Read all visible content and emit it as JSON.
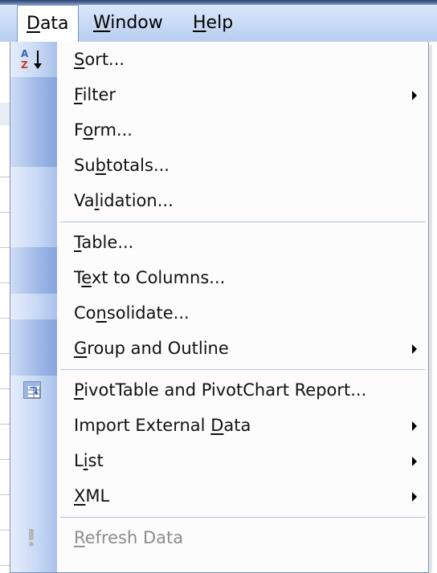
{
  "menubar": {
    "items": [
      {
        "label": "Data",
        "mnemonic_index": 0,
        "active": true
      },
      {
        "label": "Window",
        "mnemonic_index": 0,
        "active": false
      },
      {
        "label": "Help",
        "mnemonic_index": 0,
        "active": false
      }
    ]
  },
  "data_menu": {
    "items": [
      {
        "label": "Sort...",
        "mnemonic_index": 0,
        "icon": "sort-az-icon",
        "submenu": false,
        "disabled": false
      },
      {
        "label": "Filter",
        "mnemonic_index": 0,
        "icon": null,
        "submenu": true,
        "disabled": false
      },
      {
        "label": "Form...",
        "mnemonic_index": 1,
        "icon": null,
        "submenu": false,
        "disabled": false
      },
      {
        "label": "Subtotals...",
        "mnemonic_index": 2,
        "icon": null,
        "submenu": false,
        "disabled": false
      },
      {
        "label": "Validation...",
        "mnemonic_index": 2,
        "icon": null,
        "submenu": false,
        "disabled": false
      },
      {
        "label": "Table...",
        "mnemonic_index": 0,
        "icon": null,
        "submenu": false,
        "disabled": false
      },
      {
        "label": "Text to Columns...",
        "mnemonic_index": 1,
        "icon": null,
        "submenu": false,
        "disabled": false
      },
      {
        "label": "Consolidate...",
        "mnemonic_index": 2,
        "icon": null,
        "submenu": false,
        "disabled": false
      },
      {
        "label": "Group and Outline",
        "mnemonic_index": 0,
        "icon": null,
        "submenu": true,
        "disabled": false
      },
      {
        "label": "PivotTable and PivotChart Report...",
        "mnemonic_index": 0,
        "icon": "pivot-table-icon",
        "submenu": false,
        "disabled": false
      },
      {
        "label": "Import External Data",
        "mnemonic_index": 16,
        "icon": null,
        "submenu": true,
        "disabled": false
      },
      {
        "label": "List",
        "mnemonic_index": 1,
        "icon": null,
        "submenu": true,
        "disabled": false
      },
      {
        "label": "XML",
        "mnemonic_index": 0,
        "icon": null,
        "submenu": true,
        "disabled": false
      },
      {
        "label": "Refresh Data",
        "mnemonic_index": 0,
        "icon": "refresh-exclamation-icon",
        "submenu": false,
        "disabled": true
      }
    ]
  }
}
